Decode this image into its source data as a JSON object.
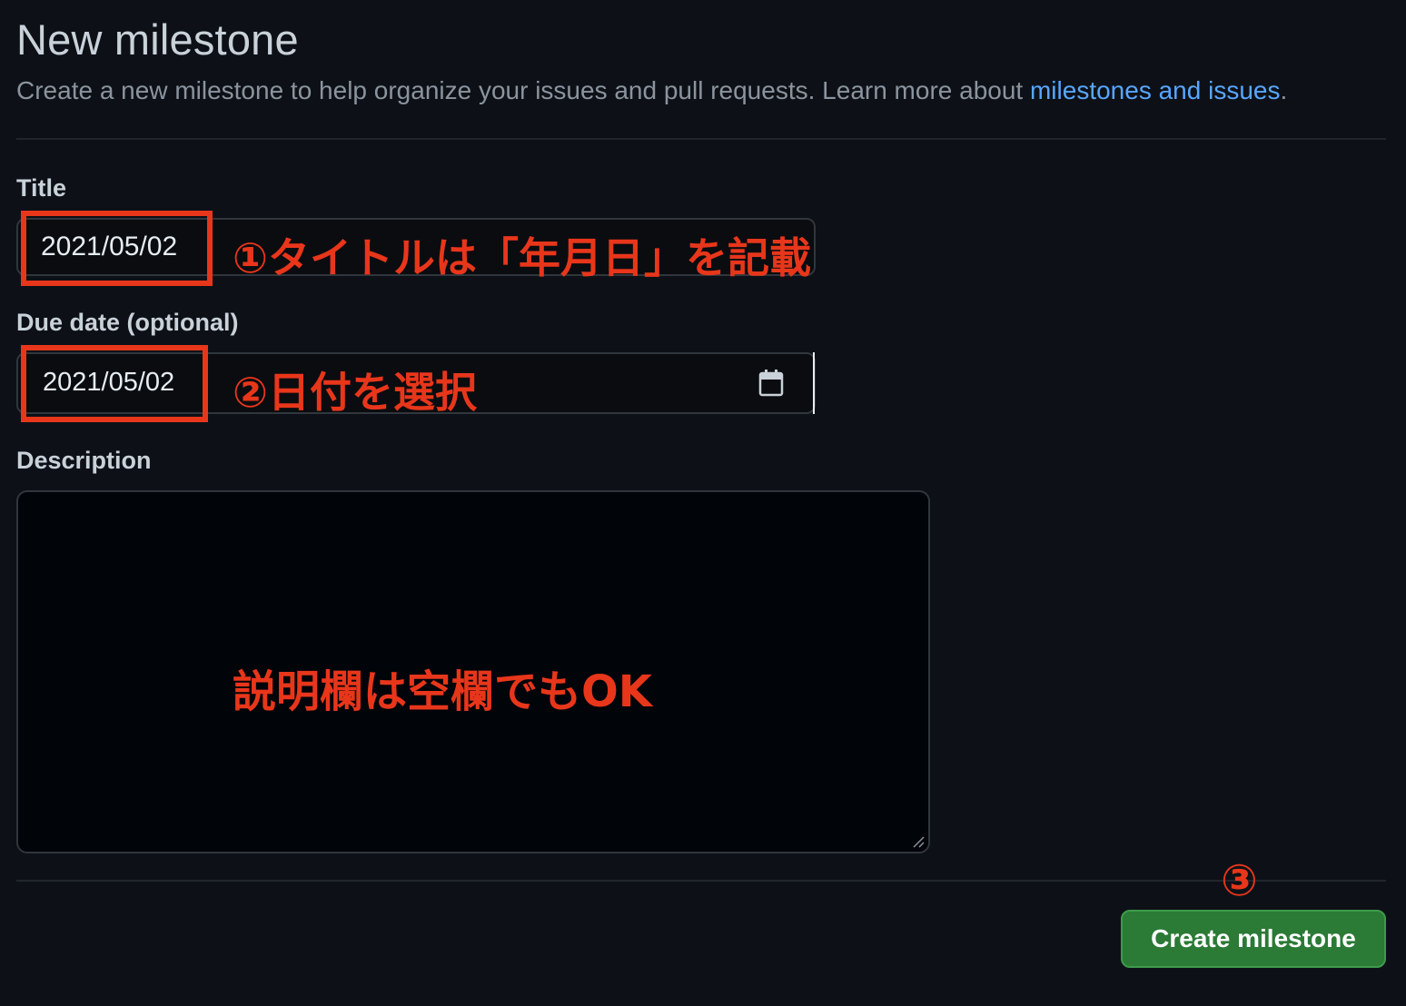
{
  "header": {
    "title": "New milestone",
    "subtitle_text": "Create a new milestone to help organize your issues and pull requests. Learn more about ",
    "subtitle_link": "milestones and issues",
    "subtitle_end": "."
  },
  "form": {
    "title_label": "Title",
    "title_value": "2021/05/02",
    "due_label": "Due date (optional)",
    "due_value": "2021/05/02",
    "description_label": "Description",
    "description_value": ""
  },
  "annotations": {
    "step1": "①タイトルは「年月日」を記載",
    "step2": "②日付を選択",
    "description_note": "説明欄は空欄でもOK",
    "step3": "③"
  },
  "actions": {
    "create_label": "Create milestone"
  },
  "icons": {
    "calendar": "calendar-icon",
    "resize": "resize-handle-icon"
  },
  "colors": {
    "background": "#0d1117",
    "link": "#58a6ff",
    "annotation_red": "#e8361b",
    "button_green": "#2b7a36"
  }
}
